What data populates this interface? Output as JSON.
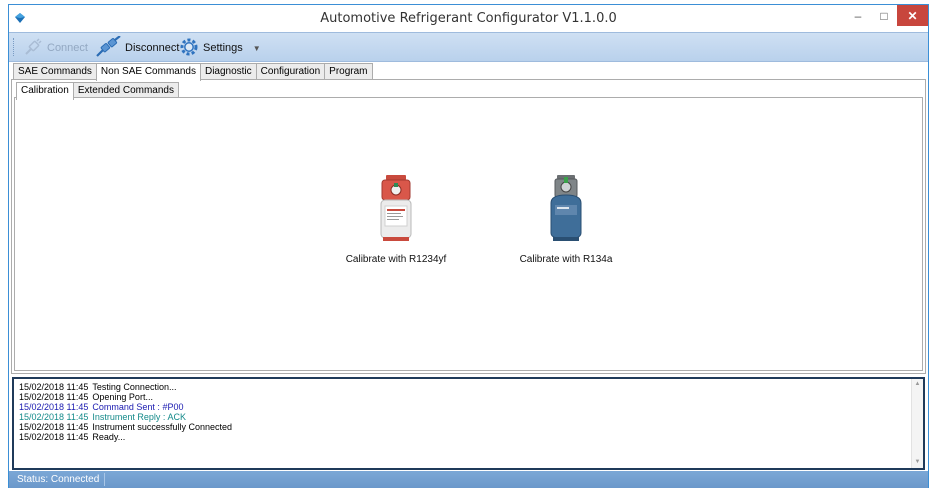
{
  "window": {
    "title": "Automotive Refrigerant Configurator V1.1.0.0",
    "minimize_glyph": "–",
    "maximize_glyph": "□",
    "close_glyph": "✕"
  },
  "toolbar": {
    "connect_label": "Connect",
    "disconnect_label": "Disconnect",
    "settings_label": "Settings",
    "settings_arrow": "▼"
  },
  "tabs": [
    {
      "label": "SAE Commands",
      "active": false
    },
    {
      "label": "Non SAE Commands",
      "active": true
    },
    {
      "label": "Diagnostic",
      "active": false
    },
    {
      "label": "Configuration",
      "active": false
    },
    {
      "label": "Program",
      "active": false
    }
  ],
  "subtabs": [
    {
      "label": "Calibration",
      "active": true
    },
    {
      "label": "Extended Commands",
      "active": false
    }
  ],
  "calibration": {
    "r1234yf_label": "Calibrate with R1234yf",
    "r134a_label": "Calibrate with R134a"
  },
  "log": [
    {
      "time": "15/02/2018 11:45",
      "text": "Testing Connection...",
      "color": "#000000"
    },
    {
      "time": "15/02/2018 11:45",
      "text": "Opening Port...",
      "color": "#000000"
    },
    {
      "time": "15/02/2018 11:45",
      "text": "Command Sent : #P00",
      "color": "#1a1ab0"
    },
    {
      "time": "15/02/2018 11:45",
      "text": "Instrument Reply : ACK",
      "color": "#148a8a"
    },
    {
      "time": "15/02/2018 11:45",
      "text": "Instrument successfully Connected",
      "color": "#000000"
    },
    {
      "time": "15/02/2018 11:45",
      "text": "Ready...",
      "color": "#000000"
    }
  ],
  "status": {
    "text": "Status: Connected"
  },
  "colors": {
    "accent": "#3b8fd6",
    "close_button": "#c8463d",
    "statusbar": "#6b98ca"
  }
}
